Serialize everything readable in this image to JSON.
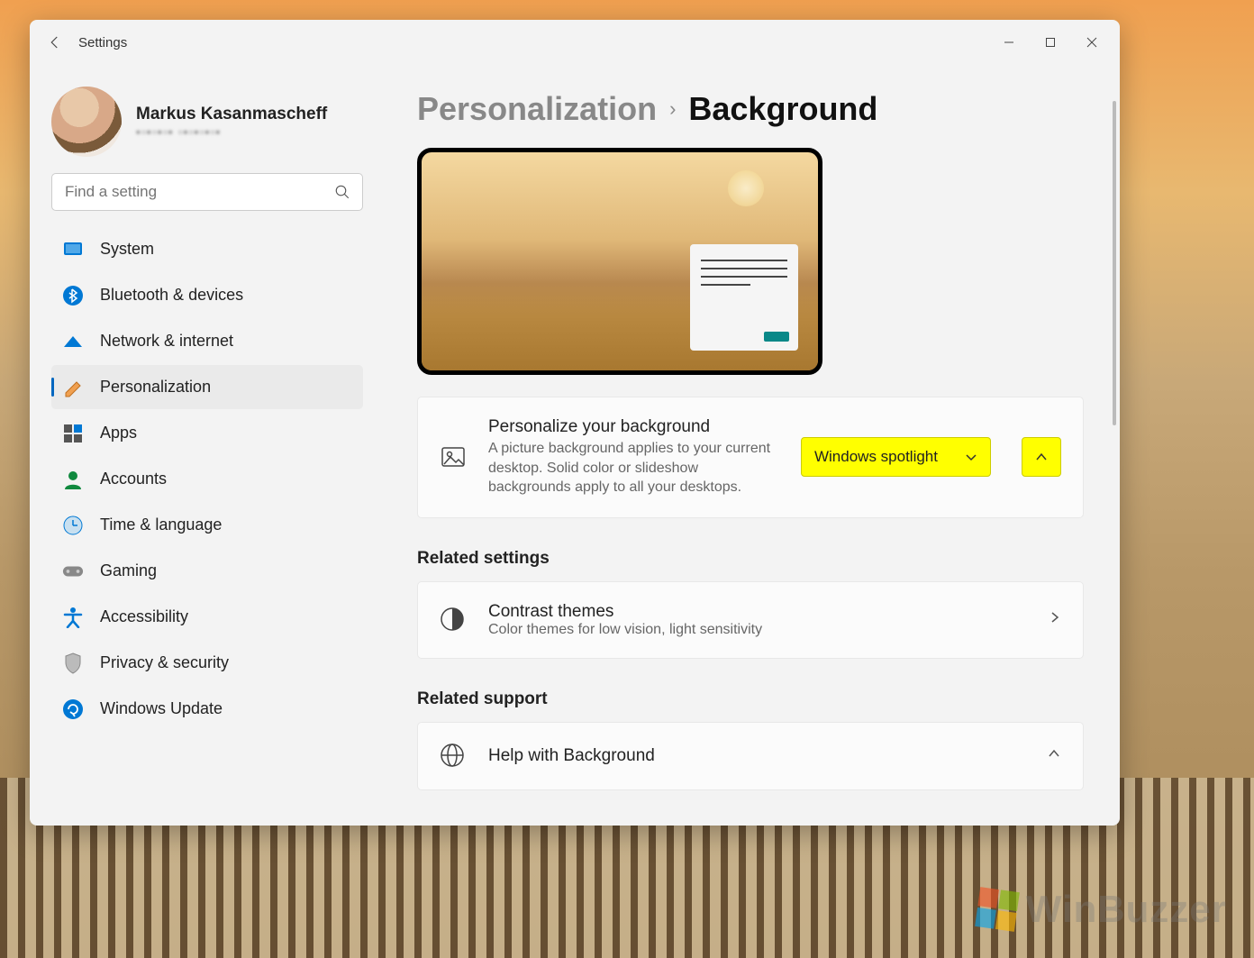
{
  "window": {
    "title": "Settings"
  },
  "profile": {
    "name": "Markus Kasanmascheff",
    "email_obscured": "▪▫▪▫▪▫▪ ▫▪▫▪▫▪▫▪"
  },
  "search": {
    "placeholder": "Find a setting"
  },
  "sidebar": {
    "items": [
      {
        "label": "System",
        "icon": "system"
      },
      {
        "label": "Bluetooth & devices",
        "icon": "bluetooth"
      },
      {
        "label": "Network & internet",
        "icon": "network"
      },
      {
        "label": "Personalization",
        "icon": "personalization",
        "selected": true
      },
      {
        "label": "Apps",
        "icon": "apps"
      },
      {
        "label": "Accounts",
        "icon": "accounts"
      },
      {
        "label": "Time & language",
        "icon": "time"
      },
      {
        "label": "Gaming",
        "icon": "gaming"
      },
      {
        "label": "Accessibility",
        "icon": "accessibility"
      },
      {
        "label": "Privacy & security",
        "icon": "privacy"
      },
      {
        "label": "Windows Update",
        "icon": "update"
      }
    ]
  },
  "breadcrumb": {
    "parent": "Personalization",
    "current": "Background"
  },
  "background_setting": {
    "title": "Personalize your background",
    "description": "A picture background applies to your current desktop. Solid color or slideshow backgrounds apply to all your desktops.",
    "dropdown_value": "Windows spotlight"
  },
  "related_settings": {
    "heading": "Related settings",
    "items": [
      {
        "title": "Contrast themes",
        "description": "Color themes for low vision, light sensitivity"
      }
    ]
  },
  "related_support": {
    "heading": "Related support",
    "items": [
      {
        "title": "Help with Background"
      }
    ]
  },
  "watermark": "WinBuzzer"
}
